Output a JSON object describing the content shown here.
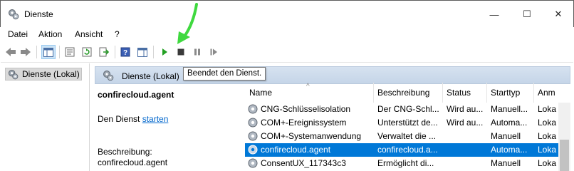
{
  "window": {
    "title": "Dienste",
    "minimize_glyph": "—",
    "maximize_glyph": "☐",
    "close_glyph": "✕"
  },
  "menu": [
    "Datei",
    "Aktion",
    "Ansicht",
    "?"
  ],
  "toolbar": {
    "buttons": [
      "back-icon",
      "forward-icon",
      "show-hide-console-tree-icon",
      "properties-icon",
      "refresh-icon",
      "export-list-icon",
      "help-icon",
      "show-hide-action-pane-icon",
      "start-service-icon",
      "stop-service-icon",
      "pause-service-icon",
      "resume-service-icon"
    ],
    "tooltip": "Beendet den Dienst."
  },
  "tree": {
    "item": "Dienste (Lokal)"
  },
  "pane": {
    "header": "Dienste (Lokal)"
  },
  "detail": {
    "service_name": "confirecloud.agent",
    "action_prefix": "Den Dienst ",
    "action_link": "starten",
    "description_label": "Beschreibung:",
    "description_value": "confirecloud.agent"
  },
  "table": {
    "columns": [
      "Name",
      "Beschreibung",
      "Status",
      "Starttyp",
      "Anm"
    ],
    "rows": [
      {
        "name": "CNG-Schlüsselisolation",
        "description": "Der CNG-Schl...",
        "status": "Wird au...",
        "starttype": "Manuell...",
        "logon": "Loka"
      },
      {
        "name": "COM+-Ereignissystem",
        "description": "Unterstützt de...",
        "status": "Wird au...",
        "starttype": "Automa...",
        "logon": "Loka"
      },
      {
        "name": "COM+-Systemanwendung",
        "description": "Verwaltet die ...",
        "status": "",
        "starttype": "Manuell",
        "logon": "Loka"
      },
      {
        "name": "confirecloud.agent",
        "description": "confirecloud.a...",
        "status": "",
        "starttype": "Automa...",
        "logon": "Loka"
      },
      {
        "name": "ConsentUX_117343c3",
        "description": "Ermöglicht di...",
        "status": "",
        "starttype": "Manuell",
        "logon": "Loka"
      }
    ],
    "selected_index": 3
  },
  "colors": {
    "selection": "#0078d7",
    "pane_header": "#c5d5e8",
    "arrow": "#3fd93f",
    "link": "#0066cc"
  }
}
